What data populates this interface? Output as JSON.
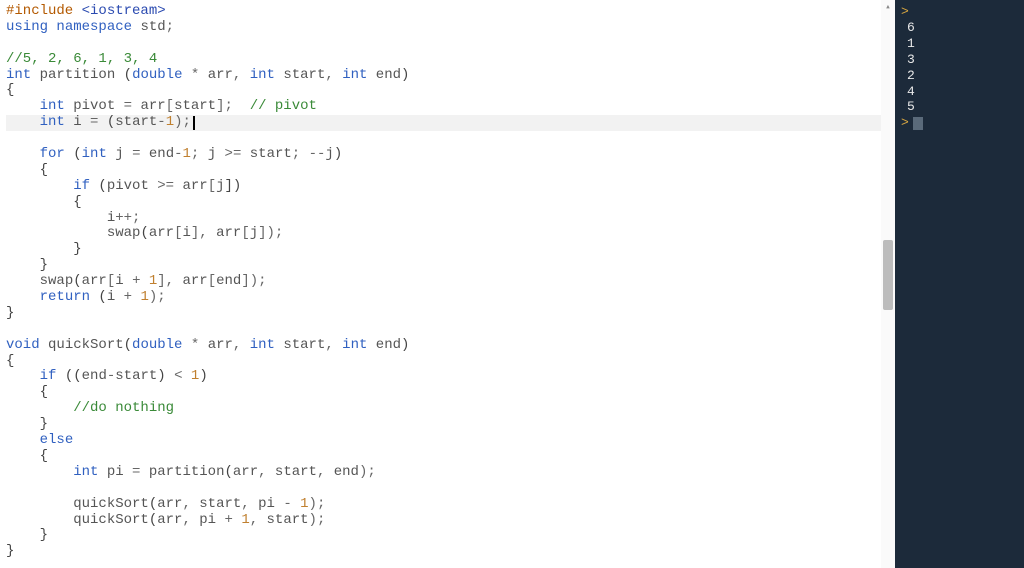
{
  "editor": {
    "highlightedLineIndex": 7,
    "lines": [
      {
        "tokens": [
          {
            "t": "#include",
            "c": "c-preproc"
          },
          {
            "t": " ",
            "c": "c-plain"
          },
          {
            "t": "<iostream>",
            "c": "c-include"
          }
        ]
      },
      {
        "tokens": [
          {
            "t": "using",
            "c": "c-keyword"
          },
          {
            "t": " ",
            "c": "c-plain"
          },
          {
            "t": "namespace",
            "c": "c-keyword"
          },
          {
            "t": " ",
            "c": "c-plain"
          },
          {
            "t": "std",
            "c": "c-ident"
          },
          {
            "t": ";",
            "c": "c-op"
          }
        ]
      },
      {
        "tokens": [
          {
            "t": " ",
            "c": "c-plain"
          }
        ]
      },
      {
        "tokens": [
          {
            "t": "//5, 2, 6, 1, 3, 4",
            "c": "c-comment"
          }
        ]
      },
      {
        "tokens": [
          {
            "t": "int",
            "c": "c-type"
          },
          {
            "t": " ",
            "c": "c-plain"
          },
          {
            "t": "partition",
            "c": "c-func"
          },
          {
            "t": " (",
            "c": "c-paren"
          },
          {
            "t": "double",
            "c": "c-type"
          },
          {
            "t": " * ",
            "c": "c-op"
          },
          {
            "t": "arr",
            "c": "c-ident"
          },
          {
            "t": ", ",
            "c": "c-op"
          },
          {
            "t": "int",
            "c": "c-type"
          },
          {
            "t": " start",
            "c": "c-ident"
          },
          {
            "t": ", ",
            "c": "c-op"
          },
          {
            "t": "int",
            "c": "c-type"
          },
          {
            "t": " end",
            "c": "c-ident"
          },
          {
            "t": ")",
            "c": "c-paren"
          }
        ]
      },
      {
        "tokens": [
          {
            "t": "{",
            "c": "c-brace"
          }
        ]
      },
      {
        "tokens": [
          {
            "t": "    ",
            "c": "c-plain"
          },
          {
            "t": "int",
            "c": "c-type"
          },
          {
            "t": " pivot ",
            "c": "c-ident"
          },
          {
            "t": "= ",
            "c": "c-op"
          },
          {
            "t": "arr",
            "c": "c-ident"
          },
          {
            "t": "[",
            "c": "c-op"
          },
          {
            "t": "start",
            "c": "c-ident"
          },
          {
            "t": "];  ",
            "c": "c-op"
          },
          {
            "t": "// pivot",
            "c": "c-comment"
          }
        ]
      },
      {
        "tokens": [
          {
            "t": "    ",
            "c": "c-plain"
          },
          {
            "t": "int",
            "c": "c-type"
          },
          {
            "t": " i ",
            "c": "c-ident"
          },
          {
            "t": "= ",
            "c": "c-op"
          },
          {
            "t": "(",
            "c": "c-paren"
          },
          {
            "t": "start",
            "c": "c-ident"
          },
          {
            "t": "-",
            "c": "c-op"
          },
          {
            "t": "1",
            "c": "c-num"
          },
          {
            "t": ");",
            "c": "c-op"
          }
        ],
        "hasCursor": true
      },
      {
        "tokens": [
          {
            "t": " ",
            "c": "c-plain"
          }
        ]
      },
      {
        "tokens": [
          {
            "t": "    ",
            "c": "c-plain"
          },
          {
            "t": "for",
            "c": "c-keyword"
          },
          {
            "t": " (",
            "c": "c-paren"
          },
          {
            "t": "int",
            "c": "c-type"
          },
          {
            "t": " j ",
            "c": "c-ident"
          },
          {
            "t": "= ",
            "c": "c-op"
          },
          {
            "t": "end",
            "c": "c-ident"
          },
          {
            "t": "-",
            "c": "c-op"
          },
          {
            "t": "1",
            "c": "c-num"
          },
          {
            "t": "; ",
            "c": "c-op"
          },
          {
            "t": "j ",
            "c": "c-ident"
          },
          {
            "t": ">= ",
            "c": "c-op"
          },
          {
            "t": "start",
            "c": "c-ident"
          },
          {
            "t": "; ",
            "c": "c-op"
          },
          {
            "t": "--",
            "c": "c-op"
          },
          {
            "t": "j",
            "c": "c-ident"
          },
          {
            "t": ")",
            "c": "c-paren"
          }
        ]
      },
      {
        "tokens": [
          {
            "t": "    {",
            "c": "c-brace"
          }
        ]
      },
      {
        "tokens": [
          {
            "t": "        ",
            "c": "c-plain"
          },
          {
            "t": "if",
            "c": "c-keyword"
          },
          {
            "t": " (",
            "c": "c-paren"
          },
          {
            "t": "pivot ",
            "c": "c-ident"
          },
          {
            "t": ">= ",
            "c": "c-op"
          },
          {
            "t": "arr",
            "c": "c-ident"
          },
          {
            "t": "[",
            "c": "c-op"
          },
          {
            "t": "j",
            "c": "c-ident"
          },
          {
            "t": "])",
            "c": "c-paren"
          }
        ]
      },
      {
        "tokens": [
          {
            "t": "        {",
            "c": "c-brace"
          }
        ]
      },
      {
        "tokens": [
          {
            "t": "            ",
            "c": "c-plain"
          },
          {
            "t": "i",
            "c": "c-ident"
          },
          {
            "t": "++;",
            "c": "c-op"
          }
        ]
      },
      {
        "tokens": [
          {
            "t": "            ",
            "c": "c-plain"
          },
          {
            "t": "swap",
            "c": "c-func"
          },
          {
            "t": "(",
            "c": "c-paren"
          },
          {
            "t": "arr",
            "c": "c-ident"
          },
          {
            "t": "[",
            "c": "c-op"
          },
          {
            "t": "i",
            "c": "c-ident"
          },
          {
            "t": "], ",
            "c": "c-op"
          },
          {
            "t": "arr",
            "c": "c-ident"
          },
          {
            "t": "[",
            "c": "c-op"
          },
          {
            "t": "j",
            "c": "c-ident"
          },
          {
            "t": "]);",
            "c": "c-op"
          }
        ]
      },
      {
        "tokens": [
          {
            "t": "        }",
            "c": "c-brace"
          }
        ]
      },
      {
        "tokens": [
          {
            "t": "    }",
            "c": "c-brace"
          }
        ]
      },
      {
        "tokens": [
          {
            "t": "    ",
            "c": "c-plain"
          },
          {
            "t": "swap",
            "c": "c-func"
          },
          {
            "t": "(",
            "c": "c-paren"
          },
          {
            "t": "arr",
            "c": "c-ident"
          },
          {
            "t": "[",
            "c": "c-op"
          },
          {
            "t": "i ",
            "c": "c-ident"
          },
          {
            "t": "+ ",
            "c": "c-op"
          },
          {
            "t": "1",
            "c": "c-num"
          },
          {
            "t": "], ",
            "c": "c-op"
          },
          {
            "t": "arr",
            "c": "c-ident"
          },
          {
            "t": "[",
            "c": "c-op"
          },
          {
            "t": "end",
            "c": "c-ident"
          },
          {
            "t": "]);",
            "c": "c-op"
          }
        ]
      },
      {
        "tokens": [
          {
            "t": "    ",
            "c": "c-plain"
          },
          {
            "t": "return",
            "c": "c-keyword"
          },
          {
            "t": " (",
            "c": "c-paren"
          },
          {
            "t": "i ",
            "c": "c-ident"
          },
          {
            "t": "+ ",
            "c": "c-op"
          },
          {
            "t": "1",
            "c": "c-num"
          },
          {
            "t": ");",
            "c": "c-op"
          }
        ]
      },
      {
        "tokens": [
          {
            "t": "}",
            "c": "c-brace"
          }
        ]
      },
      {
        "tokens": [
          {
            "t": " ",
            "c": "c-plain"
          }
        ]
      },
      {
        "tokens": [
          {
            "t": "void",
            "c": "c-type"
          },
          {
            "t": " ",
            "c": "c-plain"
          },
          {
            "t": "quickSort",
            "c": "c-func"
          },
          {
            "t": "(",
            "c": "c-paren"
          },
          {
            "t": "double",
            "c": "c-type"
          },
          {
            "t": " * ",
            "c": "c-op"
          },
          {
            "t": "arr",
            "c": "c-ident"
          },
          {
            "t": ", ",
            "c": "c-op"
          },
          {
            "t": "int",
            "c": "c-type"
          },
          {
            "t": " start",
            "c": "c-ident"
          },
          {
            "t": ", ",
            "c": "c-op"
          },
          {
            "t": "int",
            "c": "c-type"
          },
          {
            "t": " end",
            "c": "c-ident"
          },
          {
            "t": ")",
            "c": "c-paren"
          }
        ]
      },
      {
        "tokens": [
          {
            "t": "{",
            "c": "c-brace"
          }
        ]
      },
      {
        "tokens": [
          {
            "t": "    ",
            "c": "c-plain"
          },
          {
            "t": "if",
            "c": "c-keyword"
          },
          {
            "t": " ((",
            "c": "c-paren"
          },
          {
            "t": "end",
            "c": "c-ident"
          },
          {
            "t": "-",
            "c": "c-op"
          },
          {
            "t": "start",
            "c": "c-ident"
          },
          {
            "t": ") ",
            "c": "c-paren"
          },
          {
            "t": "< ",
            "c": "c-op"
          },
          {
            "t": "1",
            "c": "c-num"
          },
          {
            "t": ")",
            "c": "c-paren"
          }
        ]
      },
      {
        "tokens": [
          {
            "t": "    {",
            "c": "c-brace"
          }
        ]
      },
      {
        "tokens": [
          {
            "t": "        ",
            "c": "c-plain"
          },
          {
            "t": "//do nothing",
            "c": "c-comment"
          }
        ]
      },
      {
        "tokens": [
          {
            "t": "    }",
            "c": "c-brace"
          }
        ]
      },
      {
        "tokens": [
          {
            "t": "    ",
            "c": "c-plain"
          },
          {
            "t": "else",
            "c": "c-keyword"
          }
        ]
      },
      {
        "tokens": [
          {
            "t": "    {",
            "c": "c-brace"
          }
        ]
      },
      {
        "tokens": [
          {
            "t": "        ",
            "c": "c-plain"
          },
          {
            "t": "int",
            "c": "c-type"
          },
          {
            "t": " pi ",
            "c": "c-ident"
          },
          {
            "t": "= ",
            "c": "c-op"
          },
          {
            "t": "partition",
            "c": "c-func"
          },
          {
            "t": "(",
            "c": "c-paren"
          },
          {
            "t": "arr",
            "c": "c-ident"
          },
          {
            "t": ", ",
            "c": "c-op"
          },
          {
            "t": "start",
            "c": "c-ident"
          },
          {
            "t": ", ",
            "c": "c-op"
          },
          {
            "t": "end",
            "c": "c-ident"
          },
          {
            "t": ");",
            "c": "c-op"
          }
        ]
      },
      {
        "tokens": [
          {
            "t": " ",
            "c": "c-plain"
          }
        ]
      },
      {
        "tokens": [
          {
            "t": "        ",
            "c": "c-plain"
          },
          {
            "t": "quickSort",
            "c": "c-func"
          },
          {
            "t": "(",
            "c": "c-paren"
          },
          {
            "t": "arr",
            "c": "c-ident"
          },
          {
            "t": ", ",
            "c": "c-op"
          },
          {
            "t": "start",
            "c": "c-ident"
          },
          {
            "t": ", ",
            "c": "c-op"
          },
          {
            "t": "pi ",
            "c": "c-ident"
          },
          {
            "t": "- ",
            "c": "c-op"
          },
          {
            "t": "1",
            "c": "c-num"
          },
          {
            "t": ");",
            "c": "c-op"
          }
        ]
      },
      {
        "tokens": [
          {
            "t": "        ",
            "c": "c-plain"
          },
          {
            "t": "quickSort",
            "c": "c-func"
          },
          {
            "t": "(",
            "c": "c-paren"
          },
          {
            "t": "arr",
            "c": "c-ident"
          },
          {
            "t": ", ",
            "c": "c-op"
          },
          {
            "t": "pi ",
            "c": "c-ident"
          },
          {
            "t": "+ ",
            "c": "c-op"
          },
          {
            "t": "1",
            "c": "c-num"
          },
          {
            "t": ", ",
            "c": "c-op"
          },
          {
            "t": "start",
            "c": "c-ident"
          },
          {
            "t": ");",
            "c": "c-op"
          }
        ]
      },
      {
        "tokens": [
          {
            "t": "    }",
            "c": "c-brace"
          }
        ]
      },
      {
        "tokens": [
          {
            "t": "}",
            "c": "c-brace"
          }
        ]
      }
    ]
  },
  "output": {
    "promptGlyph": ">",
    "lines": [
      {
        "type": "prompt"
      },
      {
        "type": "value",
        "text": "6"
      },
      {
        "type": "value",
        "text": "1"
      },
      {
        "type": "value",
        "text": "3"
      },
      {
        "type": "value",
        "text": "2"
      },
      {
        "type": "value",
        "text": "4"
      },
      {
        "type": "value",
        "text": "5"
      },
      {
        "type": "prompt-cursor"
      }
    ]
  }
}
